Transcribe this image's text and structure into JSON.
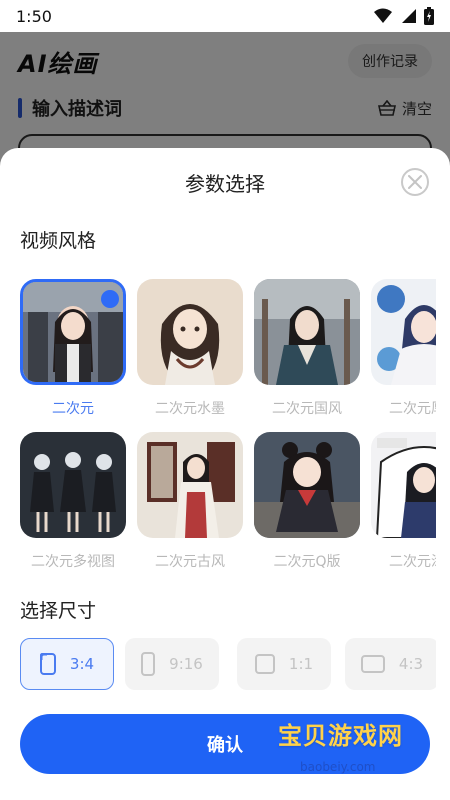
{
  "status_bar": {
    "time": "1:50",
    "icons": [
      "wifi-icon",
      "signal-icon",
      "battery-icon"
    ]
  },
  "app": {
    "logo": "AI绘画",
    "history_button": "创作记录",
    "description_title": "输入描述词",
    "clear_button": "清空"
  },
  "sheet": {
    "title": "参数选择",
    "style_section_title": "视频风格",
    "styles": [
      {
        "label": "二次元",
        "selected": true
      },
      {
        "label": "二次元水墨",
        "selected": false
      },
      {
        "label": "二次元国风",
        "selected": false
      },
      {
        "label": "二次元厚涂",
        "selected": false
      },
      {
        "label": "二次元多视图",
        "selected": false
      },
      {
        "label": "二次元古风",
        "selected": false
      },
      {
        "label": "二次元Q版",
        "selected": false
      },
      {
        "label": "二次元涂鸦",
        "selected": false
      }
    ],
    "size_section_title": "选择尺寸",
    "sizes": [
      {
        "label": "3:4",
        "selected": true
      },
      {
        "label": "9:16",
        "selected": false
      },
      {
        "label": "1:1",
        "selected": false
      },
      {
        "label": "4:3",
        "selected": false
      }
    ],
    "confirm_button": "确认"
  },
  "watermark": {
    "text": "宝贝游戏网",
    "url": "baobeiy.com"
  },
  "colors": {
    "accent": "#1f63f5",
    "selected_border": "#2f6bf6",
    "label_inactive": "#b8b8b8"
  }
}
